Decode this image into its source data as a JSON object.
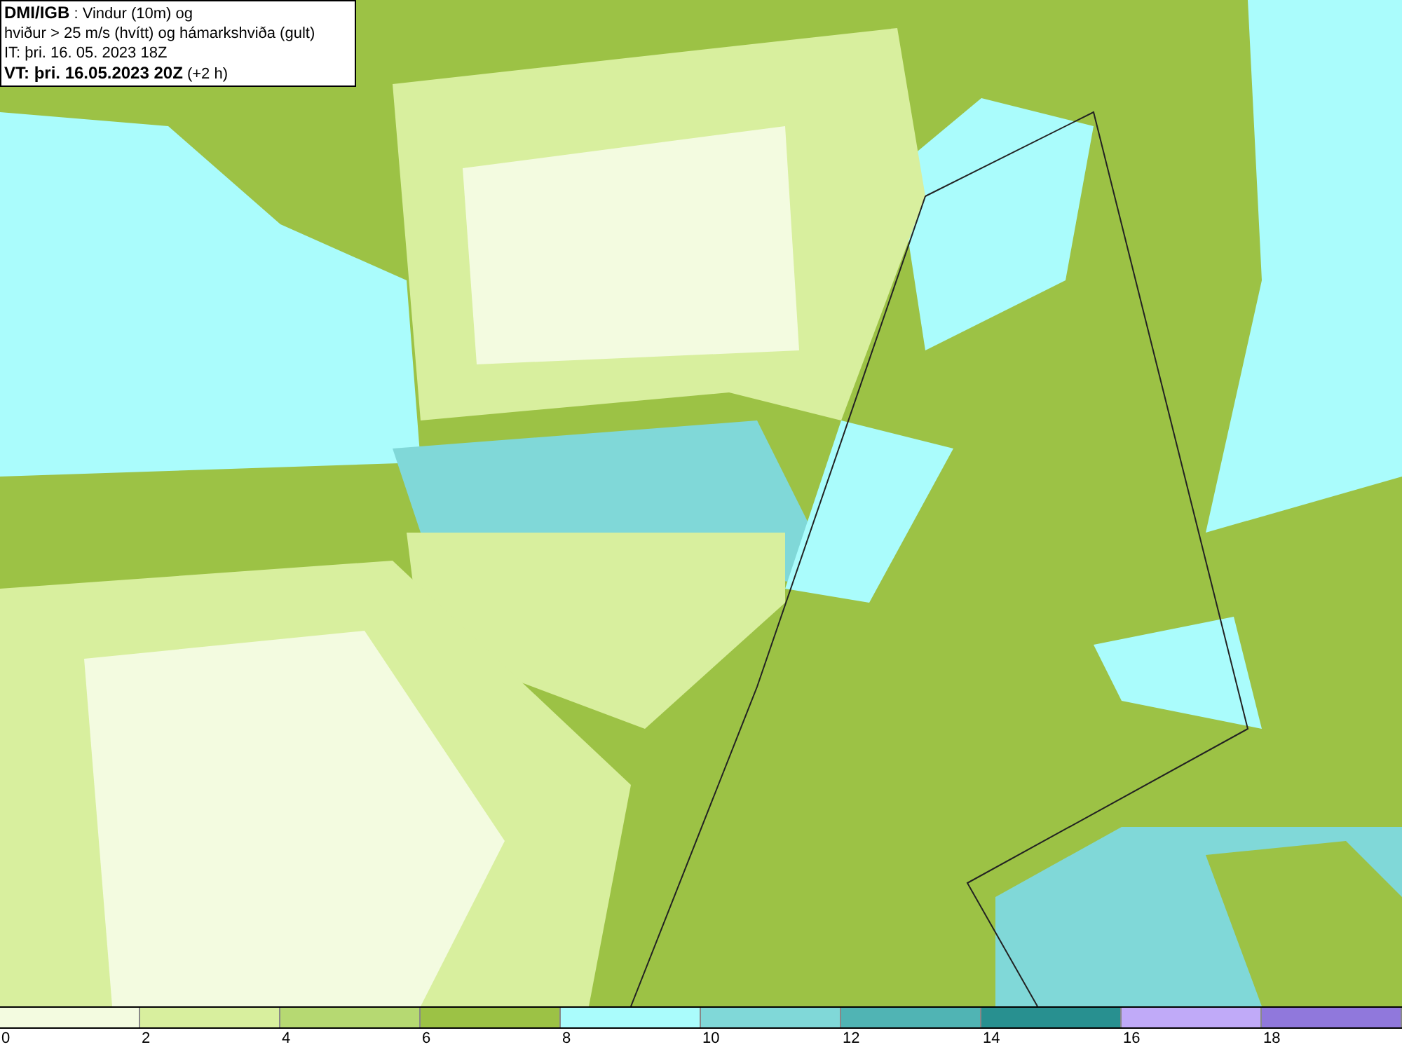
{
  "legend_box": {
    "lines": [
      "**DMI/IGB** : Vindur (10m) og",
      "hviður > 25 m/s (hvítt) og hámarkshviða (gult)",
      "IT: þri. 16. 05. 2023 18Z",
      "**VT: þri. 16.05.2023 20Z** (+2 h)"
    ]
  },
  "colorbar": {
    "bins": [
      {
        "color": "#f3fbe0"
      },
      {
        "color": "#d8ef9e"
      },
      {
        "color": "#b6d972"
      },
      {
        "color": "#9cc245"
      },
      {
        "color": "#aafcfc"
      },
      {
        "color": "#80d8d8"
      },
      {
        "color": "#50b4b4"
      },
      {
        "color": "#289090"
      },
      {
        "color": "#c0aaf8"
      },
      {
        "color": "#9078dc"
      }
    ],
    "ticks": [
      "0",
      "2",
      "4",
      "6",
      "8",
      "10",
      "12",
      "14",
      "16",
      "18"
    ]
  }
}
